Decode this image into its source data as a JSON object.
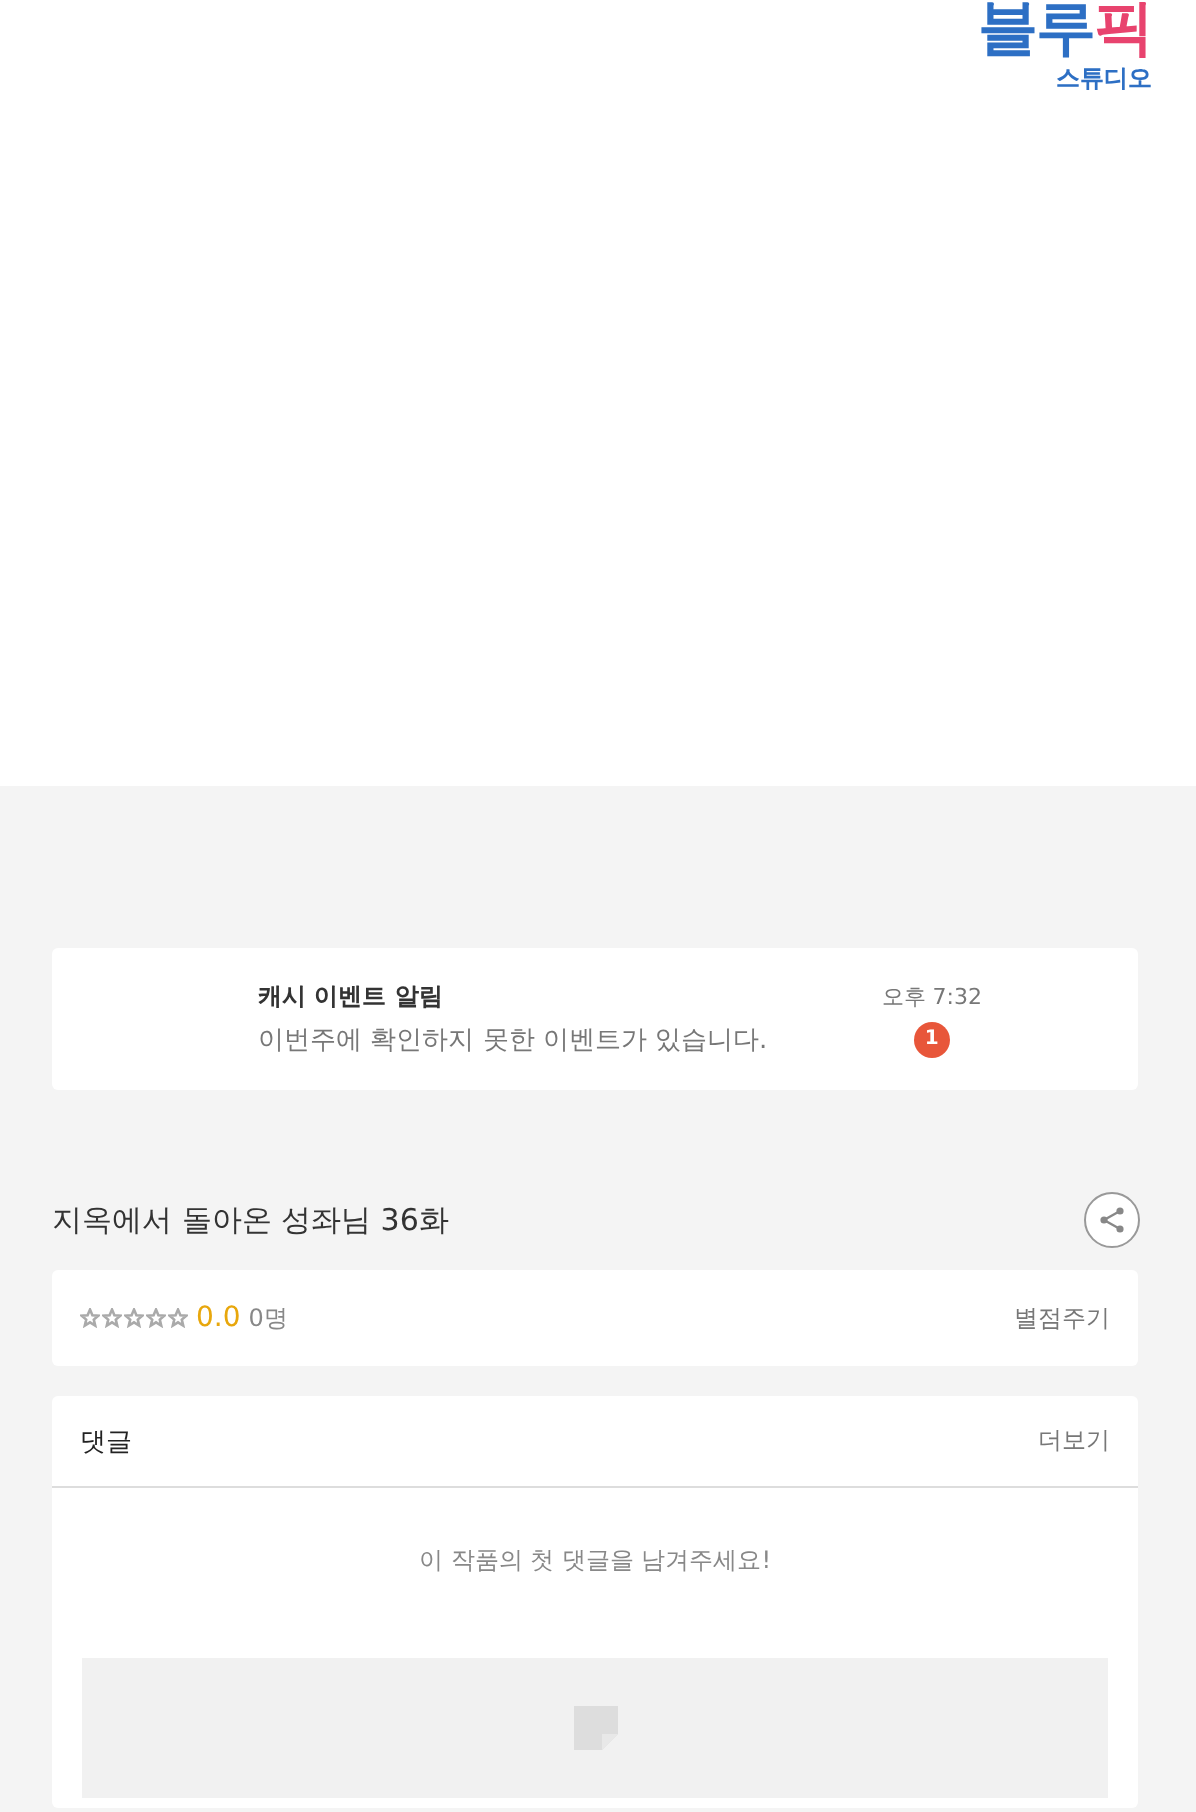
{
  "logo": {
    "part_1": "블루",
    "part_2": "픽",
    "subtitle": "스튜디오"
  },
  "notice": {
    "title": "캐시 이벤트 알림",
    "message": "이번주에 확인하지 못한 이벤트가 있습니다.",
    "time": "오후 7:32",
    "badge": "1"
  },
  "episode": {
    "title": "지옥에서 돌아온 성좌님 36화"
  },
  "rating": {
    "stars": 0,
    "score": "0.0",
    "count": "0명",
    "action": "별점주기"
  },
  "comments": {
    "title": "댓글",
    "more": "더보기",
    "empty_message": "이 작품의 첫 댓글을 남겨주세요!"
  }
}
